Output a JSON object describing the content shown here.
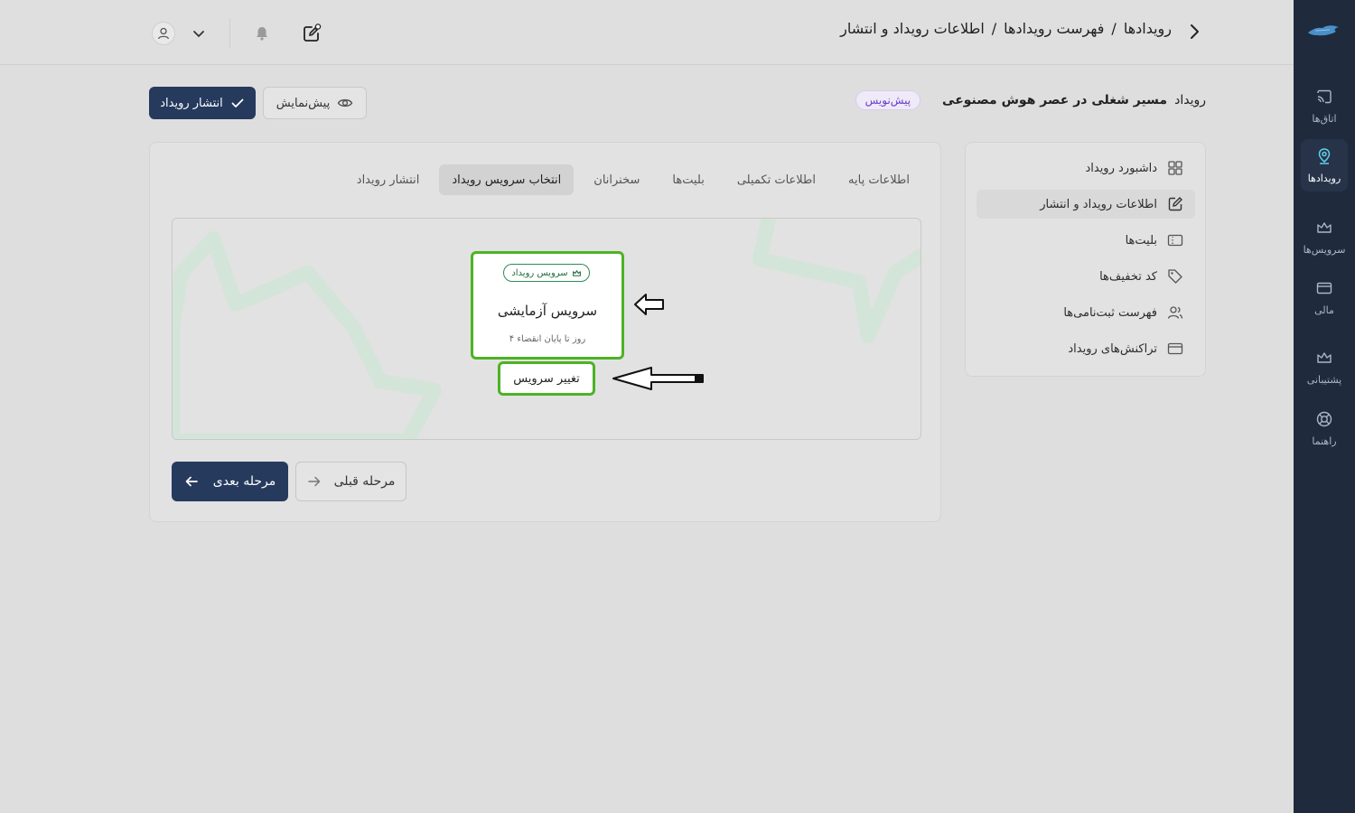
{
  "rail": {
    "items": [
      {
        "label": "اتاق‌ها",
        "icon": "cast-icon"
      },
      {
        "label": "رویدادها",
        "icon": "location-pin-icon"
      },
      {
        "label": "سرویس‌ها",
        "icon": "crown-icon"
      },
      {
        "label": "مالی",
        "icon": "credit-card-icon"
      },
      {
        "label": "پشتیبانی",
        "icon": "crown-icon"
      },
      {
        "label": "راهنما",
        "icon": "lifebuoy-icon"
      }
    ]
  },
  "breadcrumb": {
    "items": [
      "رویدادها",
      "فهرست رویدادها",
      "اطلاعات رویداد و انتشار"
    ],
    "separator": "/"
  },
  "title": {
    "prefix": "رویداد",
    "name": "مسیر شغلی در عصر هوش مصنوعی",
    "status": "پیش‌نویس"
  },
  "actions": {
    "publish": "انتشار رویداد",
    "preview": "پیش‌نمایش"
  },
  "side_menu": {
    "items": [
      {
        "label": "داشبورد رویداد",
        "icon": "grid-icon"
      },
      {
        "label": "اطلاعات رویداد و انتشار",
        "icon": "edit-icon"
      },
      {
        "label": "بلیت‌ها",
        "icon": "ticket-icon"
      },
      {
        "label": "کد تخفیف‌ها",
        "icon": "tag-icon"
      },
      {
        "label": "فهرست ثبت‌نامی‌ها",
        "icon": "users-icon"
      },
      {
        "label": "تراکنش‌های رویداد",
        "icon": "credit-card-icon"
      }
    ]
  },
  "tabs": [
    "اطلاعات پایه",
    "اطلاعات تکمیلی",
    "بلیت‌ها",
    "سخنرانان",
    "انتخاب سرویس رویداد",
    "انتشار رویداد"
  ],
  "service": {
    "badge": "سرویس رویداد",
    "name": "سرویس آزمایشی",
    "remaining": "۴ روز تا پایان انقضاء",
    "change_button": "تغییر سرویس"
  },
  "nav": {
    "next": "مرحله بعدی",
    "prev": "مرحله قبلی"
  },
  "colors": {
    "primary": "#263a5e",
    "highlight": "#4db324",
    "rail": "#1f2a3d",
    "draft": "#6a3fd1"
  }
}
